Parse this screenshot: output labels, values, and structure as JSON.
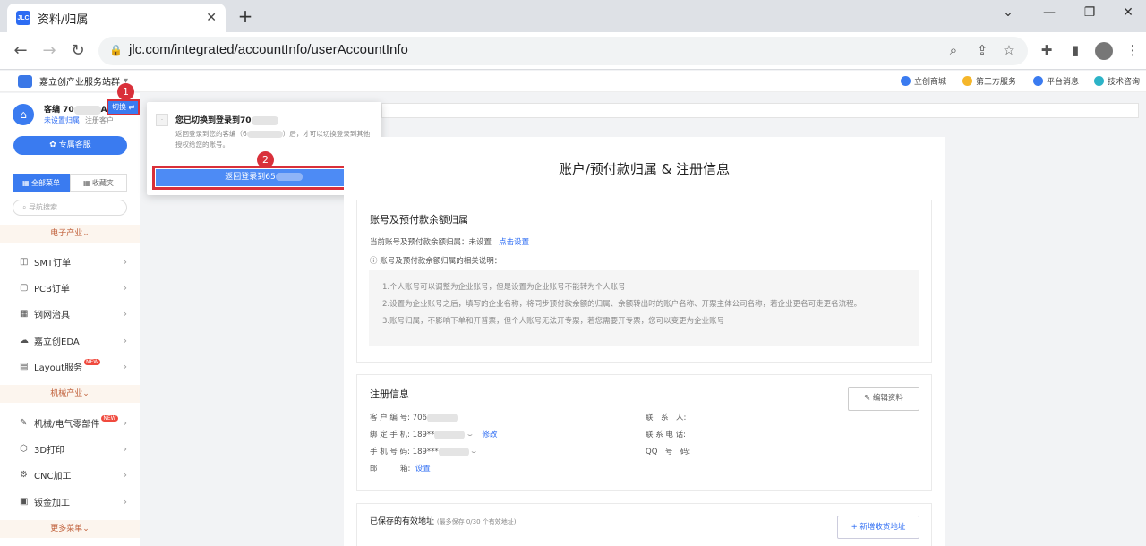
{
  "browser": {
    "tab_title": "资料/归属",
    "tab_favicon": "JLC",
    "url": "jlc.com/integrated/accountInfo/userAccountInfo"
  },
  "header": {
    "brand": "嘉立创产业服务站群",
    "links": [
      "立创商城",
      "第三方服务",
      "平台消息",
      "技术咨询"
    ]
  },
  "sidebar": {
    "account_label": "客编 70",
    "account_suffix": "A",
    "switch_label": "切换",
    "link_unset": "未设置归属",
    "link_register": "注册客户",
    "vip_button": "专属客服",
    "tab_all": "全部菜单",
    "tab_fav": "收藏夹",
    "search_placeholder": "导航搜索",
    "cat_electronics": "电子产业",
    "cat_mechanical": "机械产业",
    "more_menu": "更多菜单",
    "new_badge": "NEW",
    "items": [
      {
        "label": "SMT订单"
      },
      {
        "label": "PCB订单"
      },
      {
        "label": "钢网治具"
      },
      {
        "label": "嘉立创EDA"
      },
      {
        "label": "Layout服务"
      },
      {
        "label": "机械/电气零部件"
      },
      {
        "label": "3D打印"
      },
      {
        "label": "CNC加工"
      },
      {
        "label": "钣金加工"
      }
    ]
  },
  "popup": {
    "title": "您已切换到登录到70",
    "desc_1": "返回登录到您的客编（6",
    "desc_2": "）后，才可以切换登录到其他授权给您的账号。",
    "return_button": "返回登录到65"
  },
  "steps": [
    "1",
    "2"
  ],
  "main": {
    "title": "账户/预付款归属 & 注册信息",
    "section1": {
      "title": "账号及预付款余额归属",
      "current_label": "当前账号及预付款余额归属：未设置",
      "current_link": "点击设置",
      "note_header": "ⓘ 账号及预付款余额归属的相关说明：",
      "notes": [
        "1.个人账号可以调整为企业账号，但是设置为企业账号不能转为个人账号",
        "2.设置为企业账号之后，填写的企业名称，将同步预付款余额的归属、余额转出时的账户名称、开票主体公司名称，若企业更名可走更名流程。",
        "3.账号归属，不影响下单和开普票，但个人账号无法开专票，若您需要开专票，您可以变更为企业账号"
      ]
    },
    "section2": {
      "title": "注册信息",
      "edit_button": "编辑资料",
      "customer_no": "客 户 编 号: 706",
      "bound_phone": "绑 定 手 机: 189**",
      "bound_phone_link": "修改",
      "mobile": "手 机 号 码: 189***",
      "email": "邮　　　箱:",
      "email_link": "设置",
      "contact": "联　系　人:",
      "contact_phone": "联 系 电 话:",
      "qq": "QQ　号　码:"
    },
    "section3": {
      "title": "已保存的有效地址",
      "hint": "(最多保存 0/30 个有效地址)",
      "add_button": "+ 新增收货地址"
    }
  }
}
